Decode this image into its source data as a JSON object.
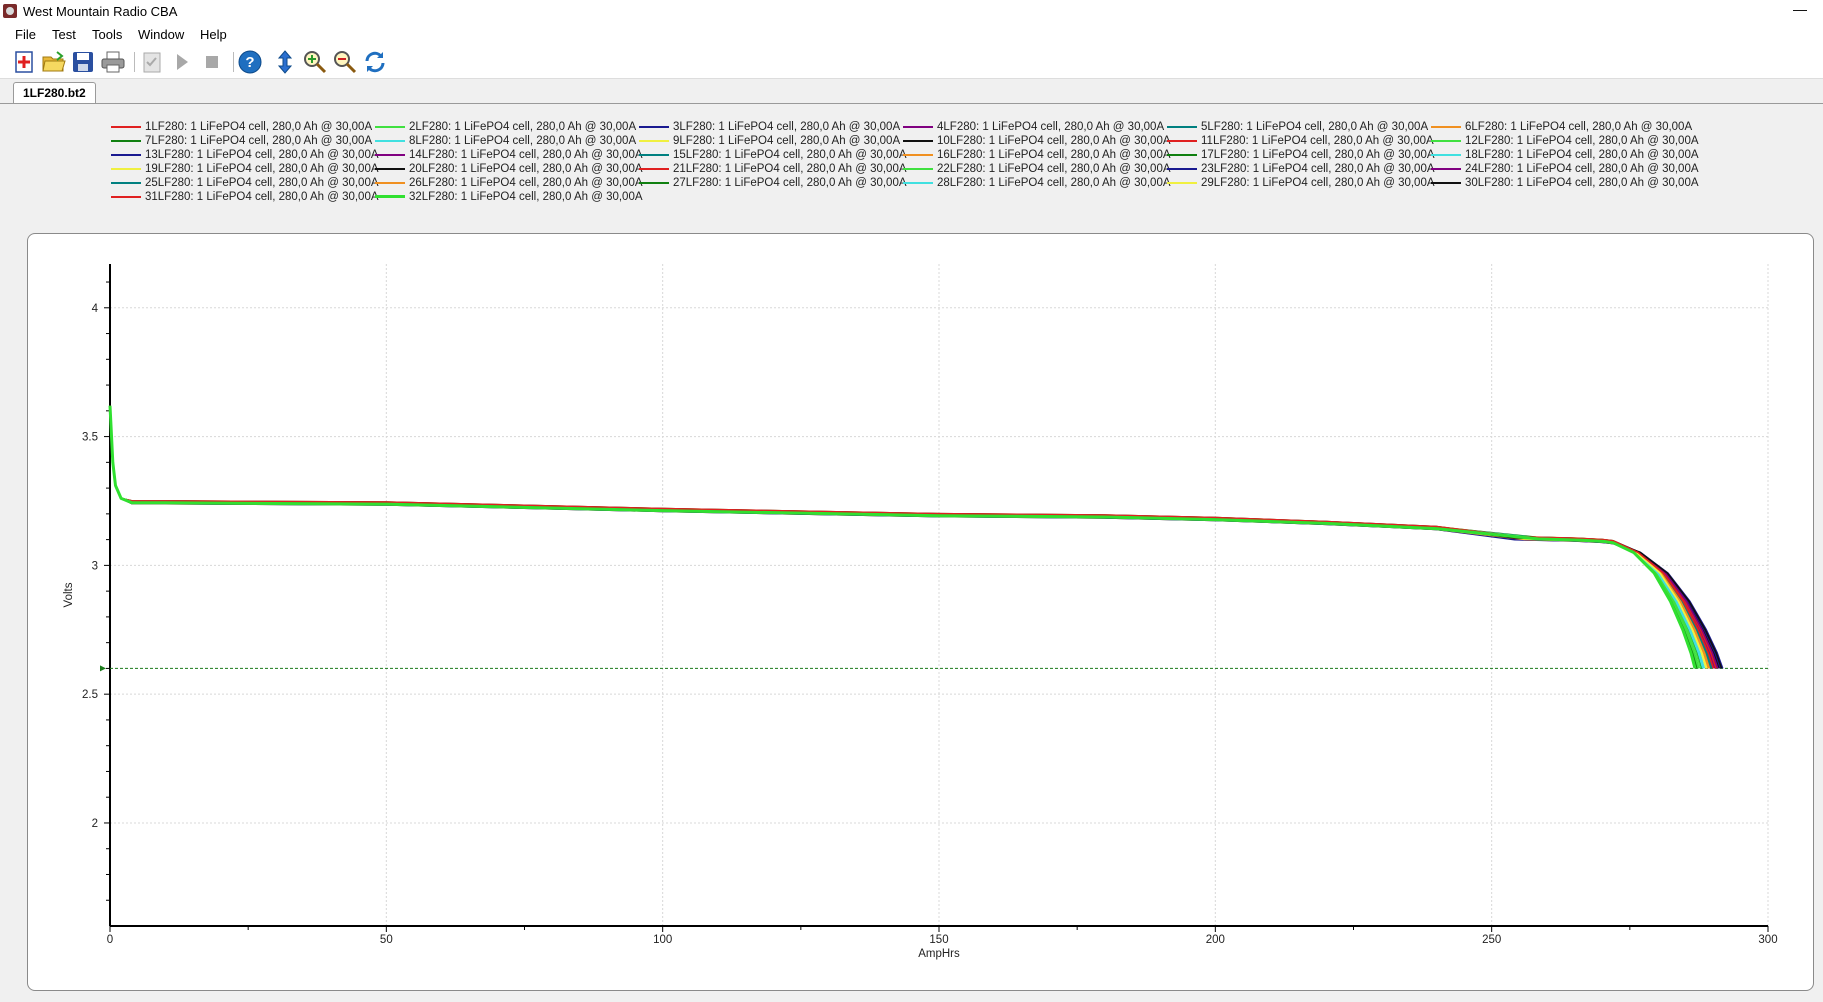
{
  "window": {
    "title": "West Mountain Radio CBA",
    "minimize_glyph": "—"
  },
  "menu": [
    {
      "label": "File"
    },
    {
      "label": "Test"
    },
    {
      "label": "Tools"
    },
    {
      "label": "Window"
    },
    {
      "label": "Help"
    }
  ],
  "toolbar": {
    "buttons": [
      {
        "icon": "new-test-icon",
        "enabled": true
      },
      {
        "icon": "open-folder-icon",
        "enabled": true
      },
      {
        "icon": "save-icon",
        "enabled": true
      },
      {
        "icon": "print-icon",
        "enabled": true
      },
      {
        "icon": "checklist-icon",
        "enabled": false
      },
      {
        "icon": "play-icon",
        "enabled": false
      },
      {
        "icon": "stop-icon",
        "enabled": false
      },
      {
        "icon": "help-icon",
        "enabled": true
      },
      {
        "icon": "vertical-scale-icon",
        "enabled": true
      },
      {
        "icon": "zoom-in-icon",
        "enabled": true
      },
      {
        "icon": "zoom-out-icon",
        "enabled": true
      },
      {
        "icon": "refresh-icon",
        "enabled": true
      }
    ]
  },
  "tabs": [
    {
      "label": "1LF280.bt2",
      "active": true
    }
  ],
  "chart_data": {
    "type": "line",
    "xlabel": "AmpHrs",
    "ylabel": "Volts",
    "xlim": [
      0,
      300
    ],
    "ylim": [
      1.6,
      4.17
    ],
    "xticks": [
      "0",
      "50",
      "100",
      "150",
      "200",
      "250",
      "300"
    ],
    "yticks": [
      "2",
      "2.5",
      "3",
      "3.5",
      "4"
    ],
    "grid": true,
    "legend_placement": "top",
    "cutoff_voltage": 2.6,
    "cutoff_color": "#1a7a1a",
    "series": [
      {
        "name": "1LF280: 1 LiFePO4 cell, 280,0 Ah @ 30,00A",
        "color": "#e02020",
        "end_ah": 290.5
      },
      {
        "name": "2LF280: 1 LiFePO4 cell, 280,0 Ah @ 30,00A",
        "color": "#40e040",
        "end_ah": 287.5
      },
      {
        "name": "3LF280: 1 LiFePO4 cell, 280,0 Ah @ 30,00A",
        "color": "#1a1a90",
        "end_ah": 291.0
      },
      {
        "name": "4LF280: 1 LiFePO4 cell, 280,0 Ah @ 30,00A",
        "color": "#800080",
        "end_ah": 290.8
      },
      {
        "name": "5LF280: 1 LiFePO4 cell, 280,0 Ah @ 30,00A",
        "color": "#008080",
        "end_ah": 290.0
      },
      {
        "name": "6LF280: 1 LiFePO4 cell, 280,0 Ah @ 30,00A",
        "color": "#f09020",
        "end_ah": 289.5
      },
      {
        "name": "7LF280: 1 LiFePO4 cell, 280,0 Ah @ 30,00A",
        "color": "#108010",
        "end_ah": 288.0
      },
      {
        "name": "8LF280: 1 LiFePO4 cell, 280,0 Ah @ 30,00A",
        "color": "#40e0e0",
        "end_ah": 288.5
      },
      {
        "name": "9LF280: 1 LiFePO4 cell, 280,0 Ah @ 30,00A",
        "color": "#f0f040",
        "end_ah": 289.0
      },
      {
        "name": "10LF280: 1 LiFePO4 cell, 280,0 Ah @ 30,00A",
        "color": "#101010",
        "end_ah": 291.5
      },
      {
        "name": "11LF280: 1 LiFePO4 cell, 280,0 Ah @ 30,00A",
        "color": "#e02020",
        "end_ah": 290.2
      },
      {
        "name": "12LF280: 1 LiFePO4 cell, 280,0 Ah @ 30,00A",
        "color": "#40e040",
        "end_ah": 287.8
      },
      {
        "name": "13LF280: 1 LiFePO4 cell, 280,0 Ah @ 30,00A",
        "color": "#1a1a90",
        "end_ah": 291.8
      },
      {
        "name": "14LF280: 1 LiFePO4 cell, 280,0 Ah @ 30,00A",
        "color": "#800080",
        "end_ah": 290.4
      },
      {
        "name": "15LF280: 1 LiFePO4 cell, 280,0 Ah @ 30,00A",
        "color": "#008080",
        "end_ah": 289.8
      },
      {
        "name": "16LF280: 1 LiFePO4 cell, 280,0 Ah @ 30,00A",
        "color": "#f09020",
        "end_ah": 289.2
      },
      {
        "name": "17LF280: 1 LiFePO4 cell, 280,0 Ah @ 30,00A",
        "color": "#108010",
        "end_ah": 287.2
      },
      {
        "name": "18LF280: 1 LiFePO4 cell, 280,0 Ah @ 30,00A",
        "color": "#40e0e0",
        "end_ah": 288.2
      },
      {
        "name": "19LF280: 1 LiFePO4 cell, 280,0 Ah @ 30,00A",
        "color": "#f0f040",
        "end_ah": 288.8
      },
      {
        "name": "20LF280: 1 LiFePO4 cell, 280,0 Ah @ 30,00A",
        "color": "#101010",
        "end_ah": 291.2
      },
      {
        "name": "21LF280: 1 LiFePO4 cell, 280,0 Ah @ 30,00A",
        "color": "#e02020",
        "end_ah": 290.6
      },
      {
        "name": "22LF280: 1 LiFePO4 cell, 280,0 Ah @ 30,00A",
        "color": "#40e040",
        "end_ah": 287.4
      },
      {
        "name": "23LF280: 1 LiFePO4 cell, 280,0 Ah @ 30,00A",
        "color": "#1a1a90",
        "end_ah": 291.4
      },
      {
        "name": "24LF280: 1 LiFePO4 cell, 280,0 Ah @ 30,00A",
        "color": "#800080",
        "end_ah": 290.9
      },
      {
        "name": "25LF280: 1 LiFePO4 cell, 280,0 Ah @ 30,00A",
        "color": "#008080",
        "end_ah": 289.6
      },
      {
        "name": "26LF280: 1 LiFePO4 cell, 280,0 Ah @ 30,00A",
        "color": "#f09020",
        "end_ah": 289.4
      },
      {
        "name": "27LF280: 1 LiFePO4 cell, 280,0 Ah @ 30,00A",
        "color": "#108010",
        "end_ah": 287.0
      },
      {
        "name": "28LF280: 1 LiFePO4 cell, 280,0 Ah @ 30,00A",
        "color": "#40e0e0",
        "end_ah": 288.4
      },
      {
        "name": "29LF280: 1 LiFePO4 cell, 280,0 Ah @ 30,00A",
        "color": "#f0f040",
        "end_ah": 288.9
      },
      {
        "name": "30LF280: 1 LiFePO4 cell, 280,0 Ah @ 30,00A",
        "color": "#101010",
        "end_ah": 291.6
      },
      {
        "name": "31LF280: 1 LiFePO4 cell, 280,0 Ah @ 30,00A",
        "color": "#e02020",
        "end_ah": 290.1
      },
      {
        "name": "32LF280: 1 LiFePO4 cell, 280,0 Ah @ 30,00A",
        "color": "#30e030",
        "end_ah": 286.8
      }
    ],
    "discharge_curve": {
      "x": [
        0,
        0.5,
        1,
        2,
        4,
        10,
        50,
        100,
        150,
        180,
        200,
        220,
        240,
        255,
        265,
        270,
        272
      ],
      "y": [
        3.62,
        3.4,
        3.31,
        3.26,
        3.245,
        3.245,
        3.24,
        3.215,
        3.195,
        3.19,
        3.18,
        3.165,
        3.145,
        3.105,
        3.1,
        3.095,
        3.09
      ]
    },
    "knee_curve": {
      "fraction": [
        0,
        0.25,
        0.5,
        0.7,
        0.85,
        0.95,
        1
      ],
      "y": [
        3.09,
        3.05,
        2.97,
        2.86,
        2.75,
        2.66,
        2.6
      ]
    }
  }
}
